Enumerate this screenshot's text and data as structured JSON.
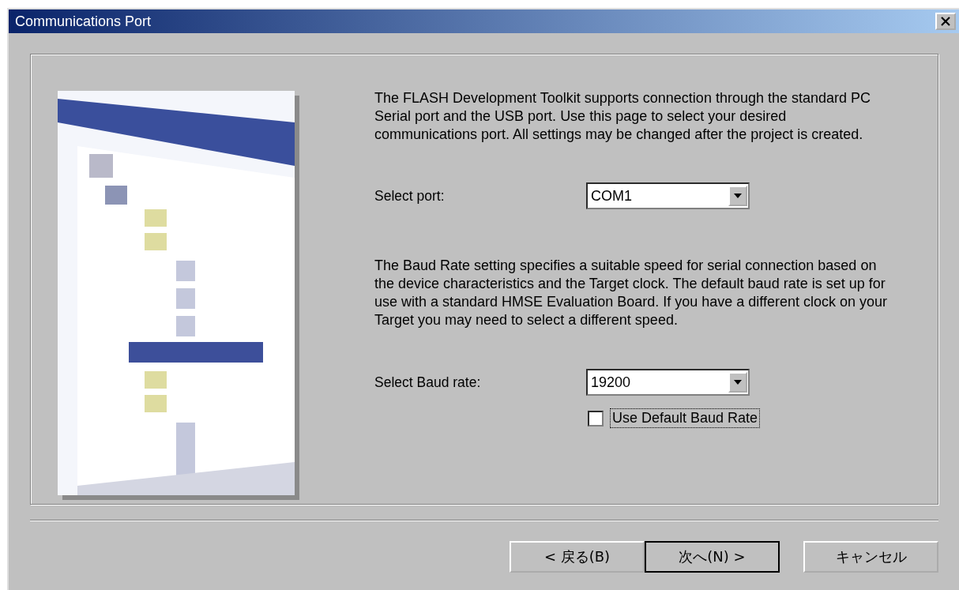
{
  "window": {
    "title": "Communications Port"
  },
  "intro": "The FLASH Development Toolkit supports connection through the standard PC Serial port and the USB port. Use this page to select your desired communications port. All settings may be changed after the project is created.",
  "port": {
    "label": "Select port:",
    "value": "COM1"
  },
  "baud_info": "The Baud Rate setting specifies a suitable speed for serial connection based on the device characteristics and the Target clock. The default baud rate is set up for use with a standard HMSE Evaluation Board. If you have a different clock on your Target you may need to select a different speed.",
  "baud": {
    "label": "Select Baud rate:",
    "value": "19200"
  },
  "use_default": {
    "label": "Use Default Baud Rate",
    "checked": false,
    "focused": true
  },
  "buttons": [
    {
      "label": "< 戻る(B)",
      "default": false
    },
    {
      "label": "次へ(N) >",
      "default": true
    },
    {
      "label": "キャンセル",
      "default": false
    }
  ]
}
